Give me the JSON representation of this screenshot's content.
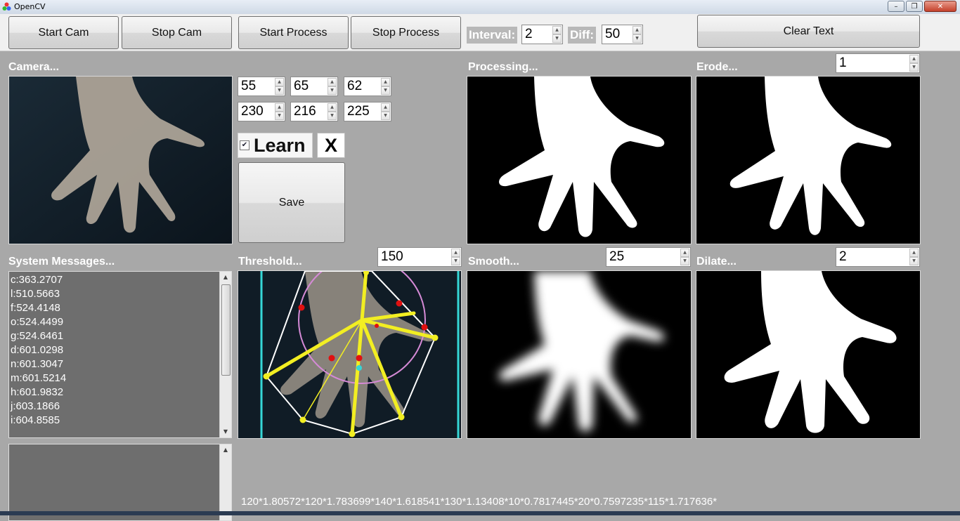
{
  "window": {
    "title": "OpenCV"
  },
  "toolbar": {
    "start_cam": "Start Cam",
    "stop_cam": "Stop  Cam",
    "start_process": "Start Process",
    "stop_process": "Stop Process",
    "interval_label": "Interval:",
    "interval_value": "2",
    "diff_label": "Diff:",
    "diff_value": "50",
    "clear_text": "Clear Text"
  },
  "camera": {
    "label": "Camera...",
    "thresholds_low": [
      "55",
      "65",
      "62"
    ],
    "thresholds_high": [
      "230",
      "216",
      "225"
    ],
    "learn_label": "Learn",
    "learn_checked": true,
    "x_label": "X",
    "save_label": "Save"
  },
  "processing": {
    "label": "Processing..."
  },
  "erode": {
    "label": "Erode...",
    "value": "1"
  },
  "system_messages": {
    "label": "System Messages...",
    "items": [
      "c:363.2707",
      "l:510.5663",
      "f:524.4148",
      "o:524.4499",
      "g:524.6461",
      "d:601.0298",
      "n:601.3047",
      "m:601.5214",
      "h:601.9832",
      "j:603.1866",
      "i:604.8585"
    ]
  },
  "threshold": {
    "label": "Threshold...",
    "value": "150"
  },
  "smooth": {
    "label": "Smooth...",
    "value": "25"
  },
  "dilate": {
    "label": "Dilate...",
    "value": "2"
  },
  "output_text": "120*1.80572*120*1.783699*140*1.618541*130*1.13408*10*0.7817445*20*0.7597235*115*1.717636*",
  "icons": {
    "app": "opencv-app-icon",
    "minimize": "minimize-icon",
    "maximize": "maximize-icon",
    "close": "close-icon",
    "check": "check-icon",
    "arrow_up": "arrow-up-icon",
    "arrow_down": "arrow-down-icon"
  },
  "colors": {
    "background": "#a8a8a8",
    "toolbar": "#f0f0f0",
    "message_bg": "#6e6e6e",
    "hull": "#ffffff",
    "skeleton": "#f2ee22",
    "circle": "#d58ad6",
    "defects": "#e01010",
    "border_line": "#35d6d6"
  }
}
